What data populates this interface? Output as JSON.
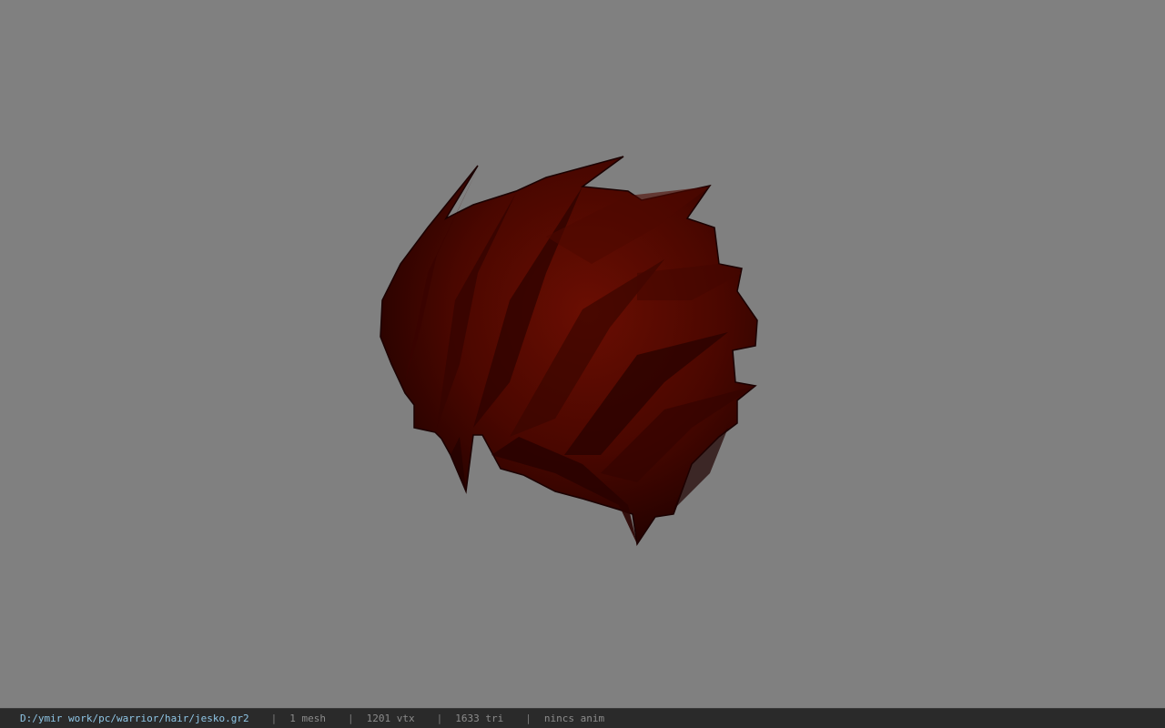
{
  "viewport": {
    "background_color": "#808080",
    "model_color": "#5a0a00",
    "model_shadow_color": "#2a0200"
  },
  "status_bar": {
    "file_path": "D:/ymir work/pc/warrior/hair/jesko.gr2",
    "separator": "|",
    "mesh_count": "1 mesh",
    "vertex_count": "1201 vtx",
    "triangle_count": "1633 tri",
    "animation": "nincs anim"
  }
}
